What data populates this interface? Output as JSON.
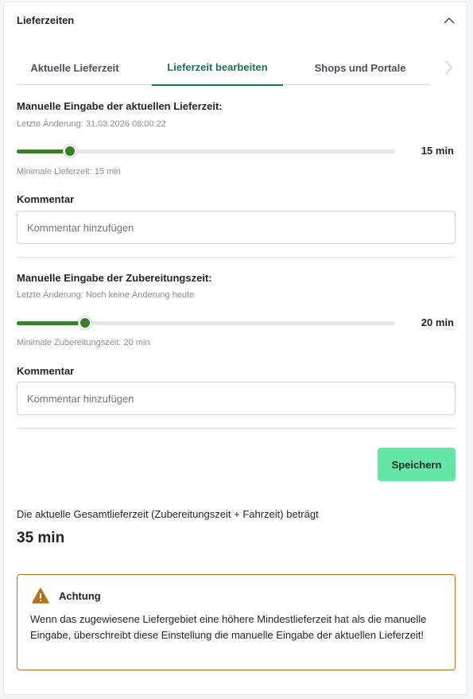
{
  "header": {
    "title": "Lieferzeiten"
  },
  "tabs": [
    {
      "label": "Aktuelle Lieferzeit",
      "active": false
    },
    {
      "label": "Lieferzeit bearbeiten",
      "active": true
    },
    {
      "label": "Shops und Portale",
      "active": false
    }
  ],
  "delivery": {
    "title": "Manuelle Eingabe der aktuellen Lieferzeit:",
    "last_change": "Letzte Änderung: 31.03.2026 08:00:22",
    "slider_value": "15 min",
    "slider_fraction": 0.14,
    "min_note": "Minimale Lieferzeit: 15 min",
    "comment_label": "Kommentar",
    "comment_placeholder": "Kommentar hinzufügen"
  },
  "prep": {
    "title": "Manuelle Eingabe der Zubereitungszeit:",
    "last_change": "Letzte Änderung: Noch keine Änderung heute",
    "slider_value": "20 min",
    "slider_fraction": 0.18,
    "min_note": "Minimale Zubereitungszeit: 20 min",
    "comment_label": "Kommentar",
    "comment_placeholder": "Kommentar hinzufügen"
  },
  "save_label": "Speichern",
  "total": {
    "text": "Die aktuelle Gesamtlieferzeit (Zubereitungszeit + Fahrzeit) beträgt",
    "value": "35 min"
  },
  "alert": {
    "title": "Achtung",
    "body": "Wenn das zugewiesene Liefergebiet eine höhere Mindestlieferzeit hat als die manuelle Eingabe, überschreibt diese Einstellung die manuelle Eingabe der aktuellen Lieferzeit!"
  },
  "icons": {
    "collapse": "chevron-up-icon",
    "tabs_next": "chevron-right-icon",
    "alert": "warning-icon"
  },
  "colors": {
    "accent": "#1e6f55",
    "slider": "#3a7d2a",
    "save_button": "#63e6a6",
    "alert_border": "#b8711b"
  }
}
